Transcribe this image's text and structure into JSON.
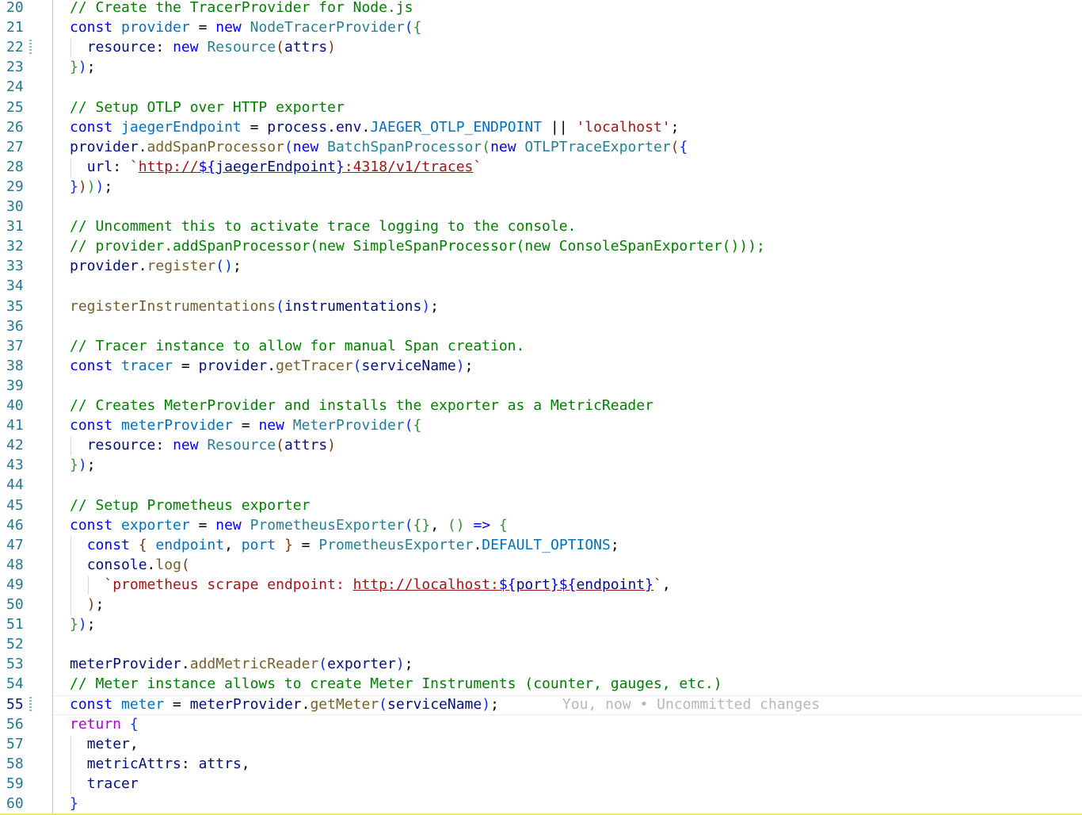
{
  "editor": {
    "line_numbers": [
      "20",
      "21",
      "22",
      "23",
      "24",
      "25",
      "26",
      "27",
      "28",
      "29",
      "30",
      "31",
      "32",
      "33",
      "34",
      "35",
      "36",
      "37",
      "38",
      "39",
      "40",
      "41",
      "42",
      "43",
      "44",
      "45",
      "46",
      "47",
      "48",
      "49",
      "50",
      "51",
      "52",
      "53",
      "54",
      "55",
      "56",
      "57",
      "58",
      "59",
      "60"
    ],
    "active_line": "55",
    "modified_lines": [
      "22",
      "55"
    ],
    "inline_blame": "You, now • Uncommitted changes",
    "colors": {
      "keyword": "#0000ff",
      "variable": "#001080",
      "class": "#267f99",
      "function": "#795e26",
      "string": "#a31515",
      "comment": "#008000",
      "constant": "#0070c1",
      "line_number": "#237893"
    },
    "code_lines": [
      [
        [
          "cmt",
          "// Create the TracerProvider for Node.js"
        ]
      ],
      [
        [
          "kw",
          "const"
        ],
        [
          "pun",
          " "
        ],
        [
          "const",
          "provider"
        ],
        [
          "pun",
          " = "
        ],
        [
          "kw",
          "new"
        ],
        [
          "pun",
          " "
        ],
        [
          "cls",
          "NodeTracerProvider"
        ],
        [
          "br1",
          "("
        ],
        [
          "br2",
          "{"
        ]
      ],
      [
        [
          "pun",
          "  "
        ],
        [
          "id",
          "resource"
        ],
        [
          "pun",
          ": "
        ],
        [
          "kw",
          "new"
        ],
        [
          "pun",
          " "
        ],
        [
          "cls",
          "Resource"
        ],
        [
          "br3",
          "("
        ],
        [
          "id",
          "attrs"
        ],
        [
          "br3",
          ")"
        ]
      ],
      [
        [
          "br2",
          "}"
        ],
        [
          "br1",
          ")"
        ],
        [
          "pun",
          ";"
        ]
      ],
      [],
      [
        [
          "cmt",
          "// Setup OTLP over HTTP exporter"
        ]
      ],
      [
        [
          "kw",
          "const"
        ],
        [
          "pun",
          " "
        ],
        [
          "const",
          "jaegerEndpoint"
        ],
        [
          "pun",
          " = "
        ],
        [
          "id",
          "process"
        ],
        [
          "pun",
          "."
        ],
        [
          "id",
          "env"
        ],
        [
          "pun",
          "."
        ],
        [
          "const",
          "JAEGER_OTLP_ENDPOINT"
        ],
        [
          "pun",
          " || "
        ],
        [
          "str",
          "'localhost'"
        ],
        [
          "pun",
          ";"
        ]
      ],
      [
        [
          "id",
          "provider"
        ],
        [
          "pun",
          "."
        ],
        [
          "fn",
          "addSpanProcessor"
        ],
        [
          "br1",
          "("
        ],
        [
          "kw",
          "new"
        ],
        [
          "pun",
          " "
        ],
        [
          "cls",
          "BatchSpanProcessor"
        ],
        [
          "br2",
          "("
        ],
        [
          "kw",
          "new"
        ],
        [
          "pun",
          " "
        ],
        [
          "cls",
          "OTLPTraceExporter"
        ],
        [
          "br3",
          "("
        ],
        [
          "br1",
          "{"
        ]
      ],
      [
        [
          "pun",
          "  "
        ],
        [
          "id",
          "url"
        ],
        [
          "pun",
          ": "
        ],
        [
          "str",
          "`"
        ],
        [
          "str link",
          "http://"
        ],
        [
          "kw link",
          "${"
        ],
        [
          "id link",
          "jaegerEndpoint"
        ],
        [
          "kw link",
          "}"
        ],
        [
          "str link",
          ":4318/v1/traces"
        ],
        [
          "str",
          "`"
        ]
      ],
      [
        [
          "br1",
          "}"
        ],
        [
          "br3",
          ")"
        ],
        [
          "br2",
          ")"
        ],
        [
          "br1",
          ")"
        ],
        [
          "pun",
          ";"
        ]
      ],
      [],
      [
        [
          "cmt",
          "// Uncomment this to activate trace logging to the console."
        ]
      ],
      [
        [
          "cmt",
          "// provider.addSpanProcessor(new SimpleSpanProcessor(new ConsoleSpanExporter()));"
        ]
      ],
      [
        [
          "id",
          "provider"
        ],
        [
          "pun",
          "."
        ],
        [
          "fn",
          "register"
        ],
        [
          "br1",
          "("
        ],
        [
          "br1",
          ")"
        ],
        [
          "pun",
          ";"
        ]
      ],
      [],
      [
        [
          "fn",
          "registerInstrumentations"
        ],
        [
          "br1",
          "("
        ],
        [
          "id",
          "instrumentations"
        ],
        [
          "br1",
          ")"
        ],
        [
          "pun",
          ";"
        ]
      ],
      [],
      [
        [
          "cmt",
          "// Tracer instance to allow for manual Span creation."
        ]
      ],
      [
        [
          "kw",
          "const"
        ],
        [
          "pun",
          " "
        ],
        [
          "const",
          "tracer"
        ],
        [
          "pun",
          " = "
        ],
        [
          "id",
          "provider"
        ],
        [
          "pun",
          "."
        ],
        [
          "fn",
          "getTracer"
        ],
        [
          "br1",
          "("
        ],
        [
          "id",
          "serviceName"
        ],
        [
          "br1",
          ")"
        ],
        [
          "pun",
          ";"
        ]
      ],
      [],
      [
        [
          "cmt",
          "// Creates MeterProvider and installs the exporter as a MetricReader"
        ]
      ],
      [
        [
          "kw",
          "const"
        ],
        [
          "pun",
          " "
        ],
        [
          "const",
          "meterProvider"
        ],
        [
          "pun",
          " = "
        ],
        [
          "kw",
          "new"
        ],
        [
          "pun",
          " "
        ],
        [
          "cls",
          "MeterProvider"
        ],
        [
          "br1",
          "("
        ],
        [
          "br2",
          "{"
        ]
      ],
      [
        [
          "pun",
          "  "
        ],
        [
          "id",
          "resource"
        ],
        [
          "pun",
          ": "
        ],
        [
          "kw",
          "new"
        ],
        [
          "pun",
          " "
        ],
        [
          "cls",
          "Resource"
        ],
        [
          "br3",
          "("
        ],
        [
          "id",
          "attrs"
        ],
        [
          "br3",
          ")"
        ]
      ],
      [
        [
          "br2",
          "}"
        ],
        [
          "br1",
          ")"
        ],
        [
          "pun",
          ";"
        ]
      ],
      [],
      [
        [
          "cmt",
          "// Setup Prometheus exporter"
        ]
      ],
      [
        [
          "kw",
          "const"
        ],
        [
          "pun",
          " "
        ],
        [
          "const",
          "exporter"
        ],
        [
          "pun",
          " = "
        ],
        [
          "kw",
          "new"
        ],
        [
          "pun",
          " "
        ],
        [
          "cls",
          "PrometheusExporter"
        ],
        [
          "br1",
          "("
        ],
        [
          "br2",
          "{}"
        ],
        [
          "pun",
          ", "
        ],
        [
          "br2",
          "()"
        ],
        [
          "pun",
          " "
        ],
        [
          "kw",
          "=>"
        ],
        [
          "pun",
          " "
        ],
        [
          "br2",
          "{"
        ]
      ],
      [
        [
          "pun",
          "  "
        ],
        [
          "kw",
          "const"
        ],
        [
          "pun",
          " "
        ],
        [
          "br3",
          "{"
        ],
        [
          "pun",
          " "
        ],
        [
          "const",
          "endpoint"
        ],
        [
          "pun",
          ", "
        ],
        [
          "const",
          "port"
        ],
        [
          "pun",
          " "
        ],
        [
          "br3",
          "}"
        ],
        [
          "pun",
          " = "
        ],
        [
          "cls",
          "PrometheusExporter"
        ],
        [
          "pun",
          "."
        ],
        [
          "const",
          "DEFAULT_OPTIONS"
        ],
        [
          "pun",
          ";"
        ]
      ],
      [
        [
          "pun",
          "  "
        ],
        [
          "id",
          "console"
        ],
        [
          "pun",
          "."
        ],
        [
          "fn",
          "log"
        ],
        [
          "br3",
          "("
        ]
      ],
      [
        [
          "pun",
          "    "
        ],
        [
          "str",
          "`"
        ],
        [
          "str",
          "prometheus scrape endpoint: "
        ],
        [
          "str link",
          "http://localhost:"
        ],
        [
          "kw link",
          "${"
        ],
        [
          "id link",
          "port"
        ],
        [
          "kw link",
          "}"
        ],
        [
          "kw link",
          "${"
        ],
        [
          "id link",
          "endpoint"
        ],
        [
          "kw link",
          "}"
        ],
        [
          "str",
          "`"
        ],
        [
          "pun",
          ","
        ]
      ],
      [
        [
          "pun",
          "  "
        ],
        [
          "br3",
          ")"
        ],
        [
          "pun",
          ";"
        ]
      ],
      [
        [
          "br2",
          "}"
        ],
        [
          "br1",
          ")"
        ],
        [
          "pun",
          ";"
        ]
      ],
      [],
      [
        [
          "id",
          "meterProvider"
        ],
        [
          "pun",
          "."
        ],
        [
          "fn",
          "addMetricReader"
        ],
        [
          "br1",
          "("
        ],
        [
          "id",
          "exporter"
        ],
        [
          "br1",
          ")"
        ],
        [
          "pun",
          ";"
        ]
      ],
      [
        [
          "cmt",
          "// Meter instance allows to create Meter Instruments (counter, gauges, etc.)"
        ]
      ],
      [
        [
          "kw",
          "const"
        ],
        [
          "pun",
          " "
        ],
        [
          "const",
          "meter"
        ],
        [
          "pun",
          " = "
        ],
        [
          "id",
          "meterProvider"
        ],
        [
          "pun",
          "."
        ],
        [
          "fn",
          "getMeter"
        ],
        [
          "br1",
          "("
        ],
        [
          "id",
          "serviceName"
        ],
        [
          "br1",
          ")"
        ],
        [
          "pun",
          ";"
        ]
      ],
      [
        [
          "ctl",
          "return"
        ],
        [
          "pun",
          " "
        ],
        [
          "br1",
          "{"
        ]
      ],
      [
        [
          "pun",
          "  "
        ],
        [
          "id",
          "meter"
        ],
        [
          "pun",
          ","
        ]
      ],
      [
        [
          "pun",
          "  "
        ],
        [
          "id",
          "metricAttrs"
        ],
        [
          "pun",
          ": "
        ],
        [
          "id",
          "attrs"
        ],
        [
          "pun",
          ","
        ]
      ],
      [
        [
          "pun",
          "  "
        ],
        [
          "id",
          "tracer"
        ]
      ],
      [
        [
          "br1",
          "}"
        ]
      ]
    ]
  }
}
